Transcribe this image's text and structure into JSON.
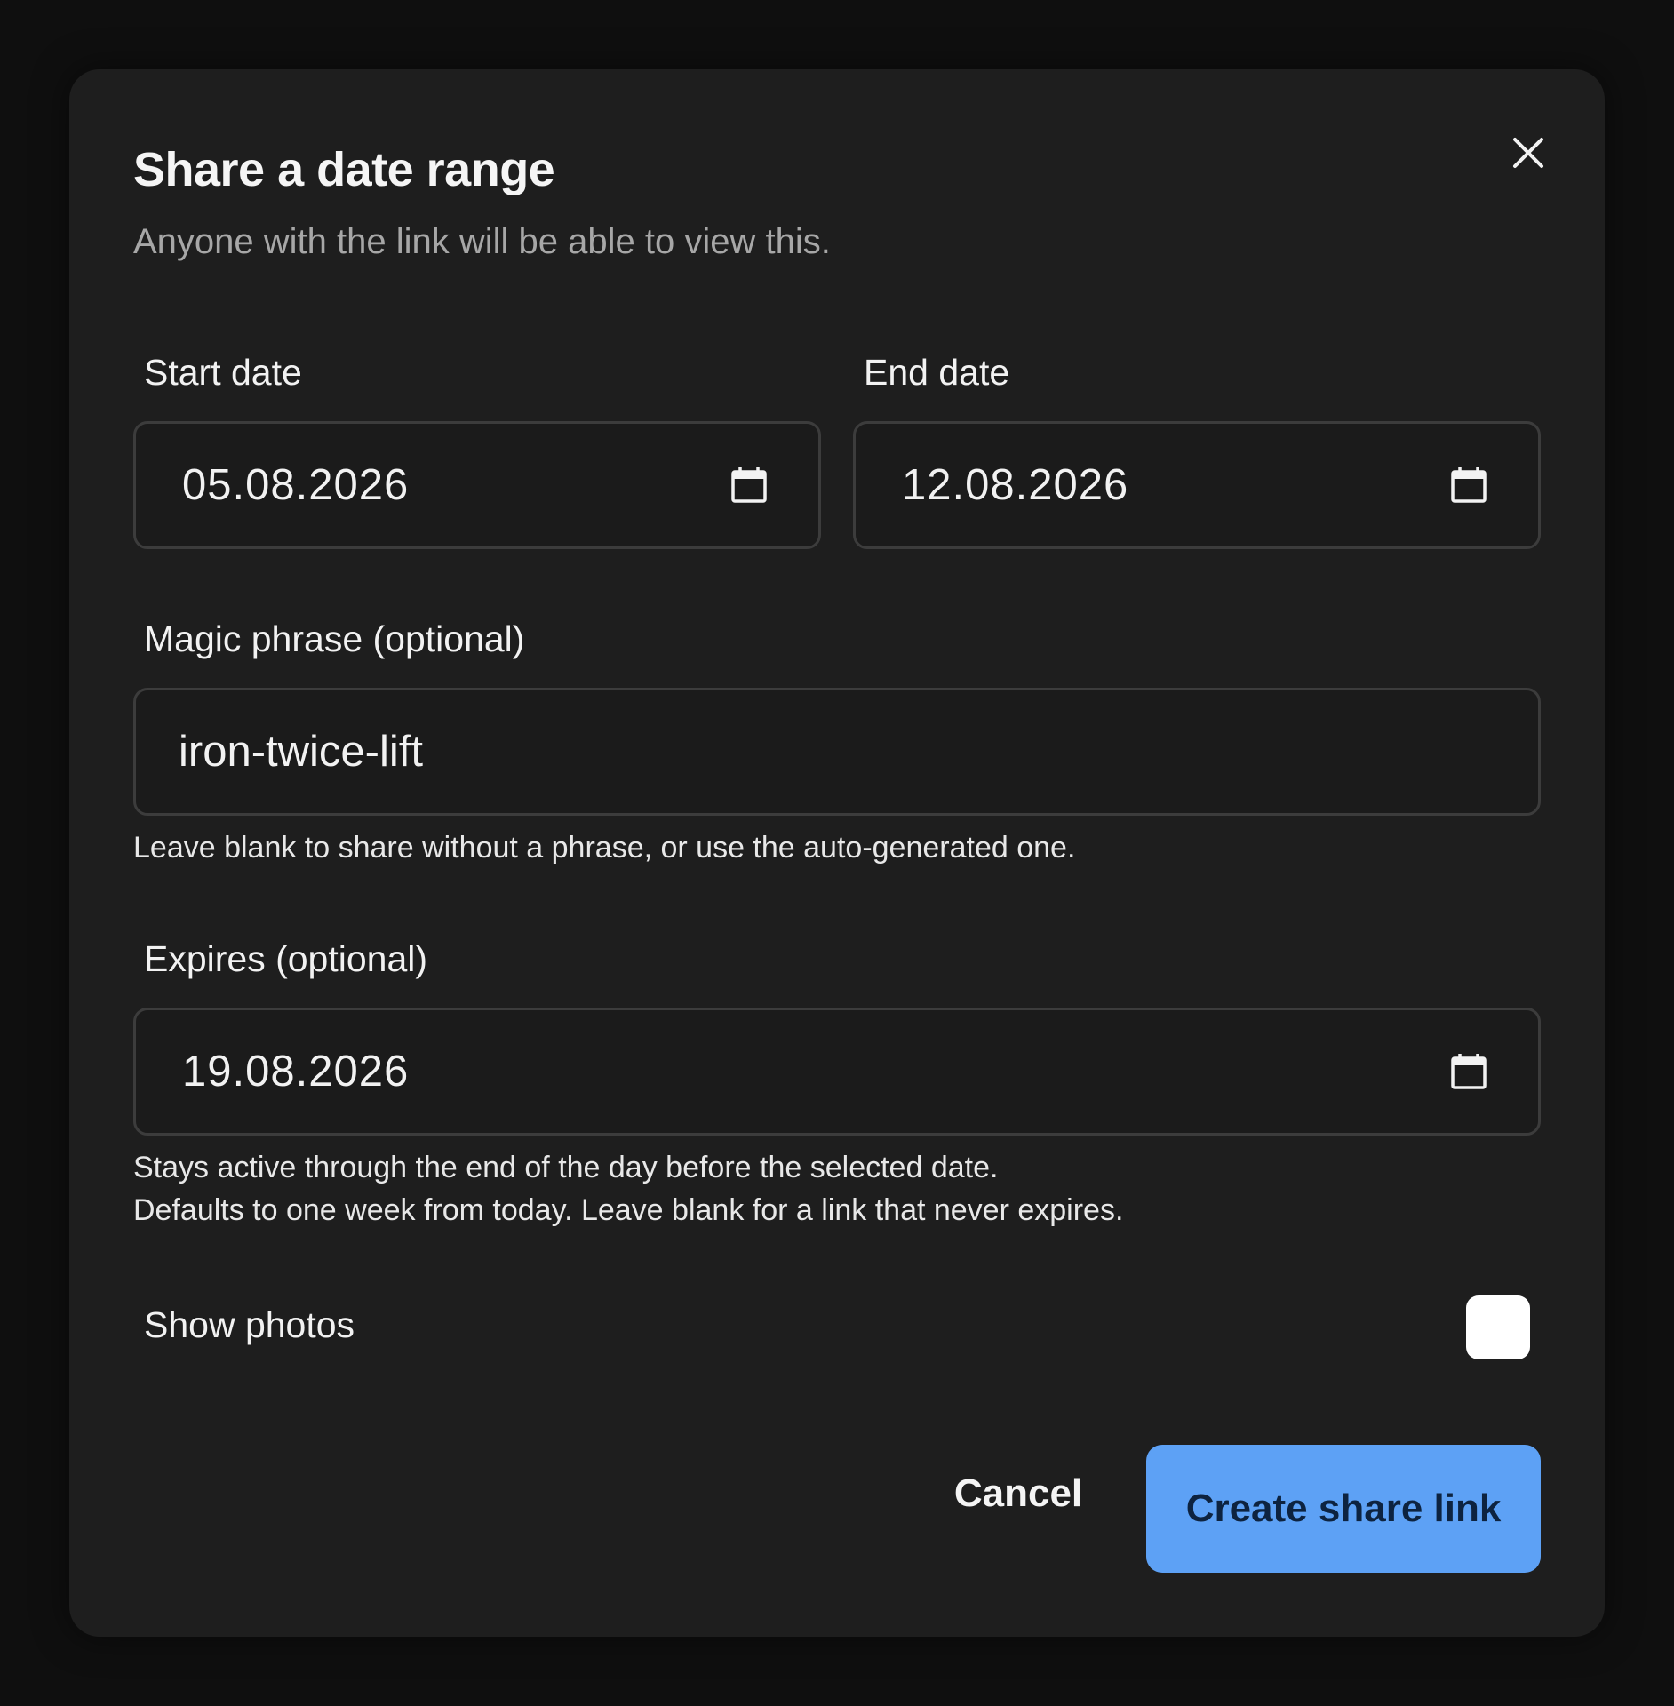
{
  "dialog": {
    "title": "Share a date range",
    "subtitle": "Anyone with the link will be able to view this."
  },
  "start_date": {
    "label": "Start date",
    "value": "05.08.2026"
  },
  "end_date": {
    "label": "End date",
    "value": "12.08.2026"
  },
  "magic_phrase": {
    "label": "Magic phrase (optional)",
    "value": "iron-twice-lift",
    "help": "Leave blank to share without a phrase, or use the auto-generated one."
  },
  "expires": {
    "label": "Expires (optional)",
    "value": "19.08.2026",
    "help_line1": "Stays active through the end of the day before the selected date.",
    "help_line2": "Defaults to one week from today. Leave blank for a link that never expires."
  },
  "show_photos": {
    "label": "Show photos",
    "checked": false
  },
  "actions": {
    "cancel": "Cancel",
    "create": "Create share link"
  },
  "colors": {
    "accent": "#5da1f5",
    "background": "#1e1e1e",
    "backdrop": "#0f0f0f"
  },
  "icons": {
    "close": "close-icon",
    "calendar": "calendar-icon"
  }
}
